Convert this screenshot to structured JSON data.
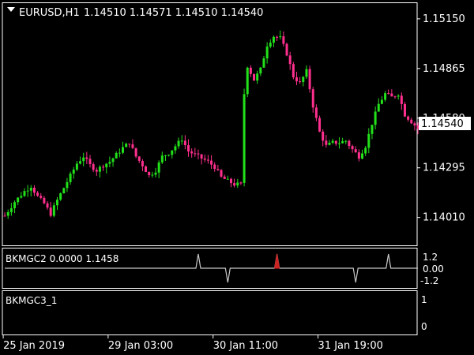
{
  "header": {
    "symbol_label": "EURUSD,H1",
    "ohlc": "1.14510 1.14571 1.14510 1.14540"
  },
  "colors": {
    "bull": "#22e01a",
    "bear": "#ff2f8e",
    "background": "#000000",
    "axis": "#ffffff",
    "indicator_line": "#c8c8c8",
    "indicator_up": "#cc2222",
    "price_label_bg": "#ffffff",
    "price_label_text": "#000000"
  },
  "indicators": [
    {
      "label": "BKMGC2 0.0000 1.1458",
      "ticks": [
        "1.2",
        "0.00",
        "-1.2"
      ]
    },
    {
      "label": "BKMGC3_1",
      "ticks": [
        "1",
        "0"
      ]
    }
  ],
  "current_price_label": "1.14540",
  "chart_data": {
    "type": "candlestick",
    "y_ticks": [
      "1.15150",
      "1.14865",
      "1.14580",
      "1.14295",
      "1.14010"
    ],
    "ylim": [
      1.1385,
      1.1524
    ],
    "x_labels": [
      "25 Jan 2019",
      "29 Jan 03:00",
      "30 Jan 11:00",
      "31 Jan 19:00"
    ],
    "x_label_bars": [
      0,
      32,
      64,
      96
    ],
    "current_price": 1.1454,
    "close_path": [
      [
        0,
        1.1402
      ],
      [
        3,
        1.141
      ],
      [
        6,
        1.1416
      ],
      [
        8,
        1.1419
      ],
      [
        10,
        1.1413
      ],
      [
        12,
        1.1409
      ],
      [
        14,
        1.1403
      ],
      [
        16,
        1.1411
      ],
      [
        18,
        1.1418
      ],
      [
        20,
        1.1425
      ],
      [
        22,
        1.1432
      ],
      [
        24,
        1.1436
      ],
      [
        26,
        1.1431
      ],
      [
        28,
        1.1428
      ],
      [
        30,
        1.1431
      ],
      [
        32,
        1.1433
      ],
      [
        34,
        1.1437
      ],
      [
        36,
        1.1441
      ],
      [
        38,
        1.1444
      ],
      [
        40,
        1.1436
      ],
      [
        42,
        1.1431
      ],
      [
        44,
        1.1425
      ],
      [
        46,
        1.1428
      ],
      [
        48,
        1.1436
      ],
      [
        50,
        1.1438
      ],
      [
        52,
        1.1442
      ],
      [
        54,
        1.1446
      ],
      [
        56,
        1.1439
      ],
      [
        58,
        1.1437
      ],
      [
        60,
        1.1435
      ],
      [
        62,
        1.1433
      ],
      [
        64,
        1.143
      ],
      [
        66,
        1.1424
      ],
      [
        68,
        1.1422
      ],
      [
        70,
        1.142
      ],
      [
        72,
        1.142
      ],
      [
        73,
        1.1472
      ],
      [
        74,
        1.1488
      ],
      [
        76,
        1.148
      ],
      [
        78,
        1.1486
      ],
      [
        80,
        1.15
      ],
      [
        82,
        1.1505
      ],
      [
        84,
        1.1504
      ],
      [
        86,
        1.1495
      ],
      [
        88,
        1.1482
      ],
      [
        90,
        1.1478
      ],
      [
        92,
        1.1485
      ],
      [
        94,
        1.1465
      ],
      [
        96,
        1.145
      ],
      [
        98,
        1.1442
      ],
      [
        100,
        1.1444
      ],
      [
        102,
        1.1444
      ],
      [
        104,
        1.1445
      ],
      [
        106,
        1.144
      ],
      [
        108,
        1.1436
      ],
      [
        110,
        1.1442
      ],
      [
        112,
        1.1455
      ],
      [
        114,
        1.1466
      ],
      [
        116,
        1.1472
      ],
      [
        118,
        1.147
      ],
      [
        120,
        1.1472
      ],
      [
        122,
        1.146
      ],
      [
        124,
        1.1456
      ],
      [
        126,
        1.1452
      ]
    ],
    "indicator_spikes": [
      {
        "bar": 59,
        "value": 1.2
      },
      {
        "bar": 68,
        "value": -1.2
      },
      {
        "bar": 83,
        "value": 1.2,
        "highlight": true
      },
      {
        "bar": 107,
        "value": -1.2
      },
      {
        "bar": 117,
        "value": 1.2
      }
    ],
    "bar_count": 126
  }
}
